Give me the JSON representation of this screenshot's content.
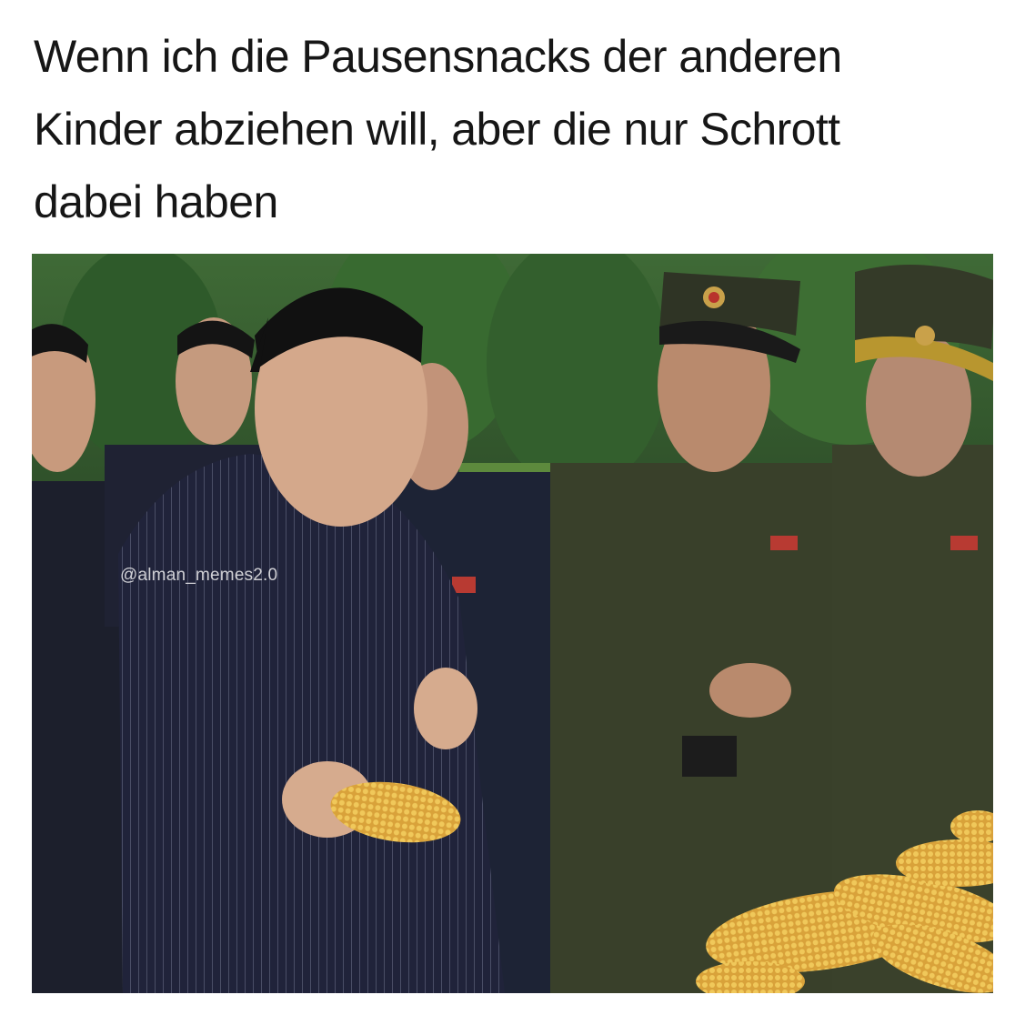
{
  "caption": {
    "lines": [
      "Wenn ich die Pausensnacks der anderen",
      "Kinder abziehen will, aber die nur Schrott",
      "dabei haben"
    ]
  },
  "photo": {
    "watermark": "@alman_memes2.0"
  }
}
